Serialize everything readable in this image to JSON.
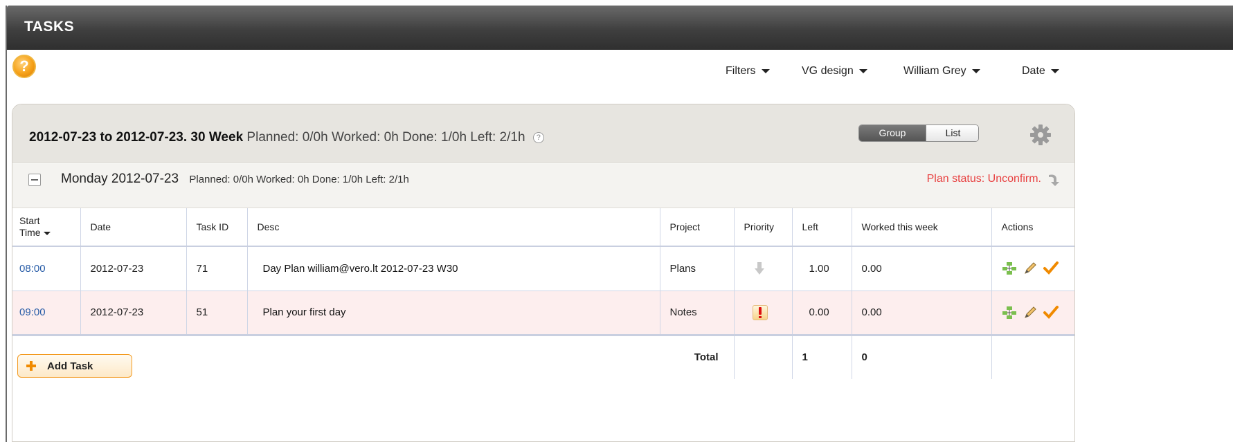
{
  "app": {
    "title": "TASKS"
  },
  "help": {
    "glyph": "?"
  },
  "toolbar": {
    "filters": "Filters",
    "project": "VG design",
    "user": "William Grey",
    "date": "Date"
  },
  "week": {
    "range": "2012-07-23 to 2012-07-23. 30 Week",
    "stats": "Planned: 0/0h  Worked: 0h  Done: 1/0h  Left: 2/1h"
  },
  "view_toggle": {
    "group": "Group",
    "list": "List",
    "selected": "Group"
  },
  "day": {
    "title": "Monday 2012-07-23",
    "stats": "Planned: 0/0h  Worked: 0h  Done: 1/0h  Left: 2/1h",
    "plan_status": "Plan status: Unconfirm."
  },
  "table": {
    "headers": {
      "start_line1": "Start",
      "start_line2": "Time",
      "date": "Date",
      "task_id": "Task ID",
      "desc": "Desc",
      "project": "Project",
      "priority": "Priority",
      "left": "Left",
      "worked": "Worked this week",
      "actions": "Actions"
    },
    "rows": [
      {
        "start": "08:00",
        "date": "2012-07-23",
        "task_id": "71",
        "desc": "Day Plan william@vero.lt 2012-07-23 W30",
        "project": "Plans",
        "priority": "low-arrow-icon",
        "left": "1.00",
        "worked": "0.00"
      },
      {
        "start": "09:00",
        "date": "2012-07-23",
        "task_id": "51",
        "desc": "Plan your first day",
        "project": "Notes",
        "priority": "exclamation-icon",
        "left": "0.00",
        "worked": "0.00"
      }
    ],
    "total": {
      "label": "Total",
      "left": "1",
      "worked": "0"
    }
  },
  "add_task": {
    "label": "Add Task"
  },
  "colors": {
    "accent": "#f39a20",
    "status": "#e84040",
    "link": "#2a5ea8",
    "highlight_row": "#fdeeee"
  }
}
